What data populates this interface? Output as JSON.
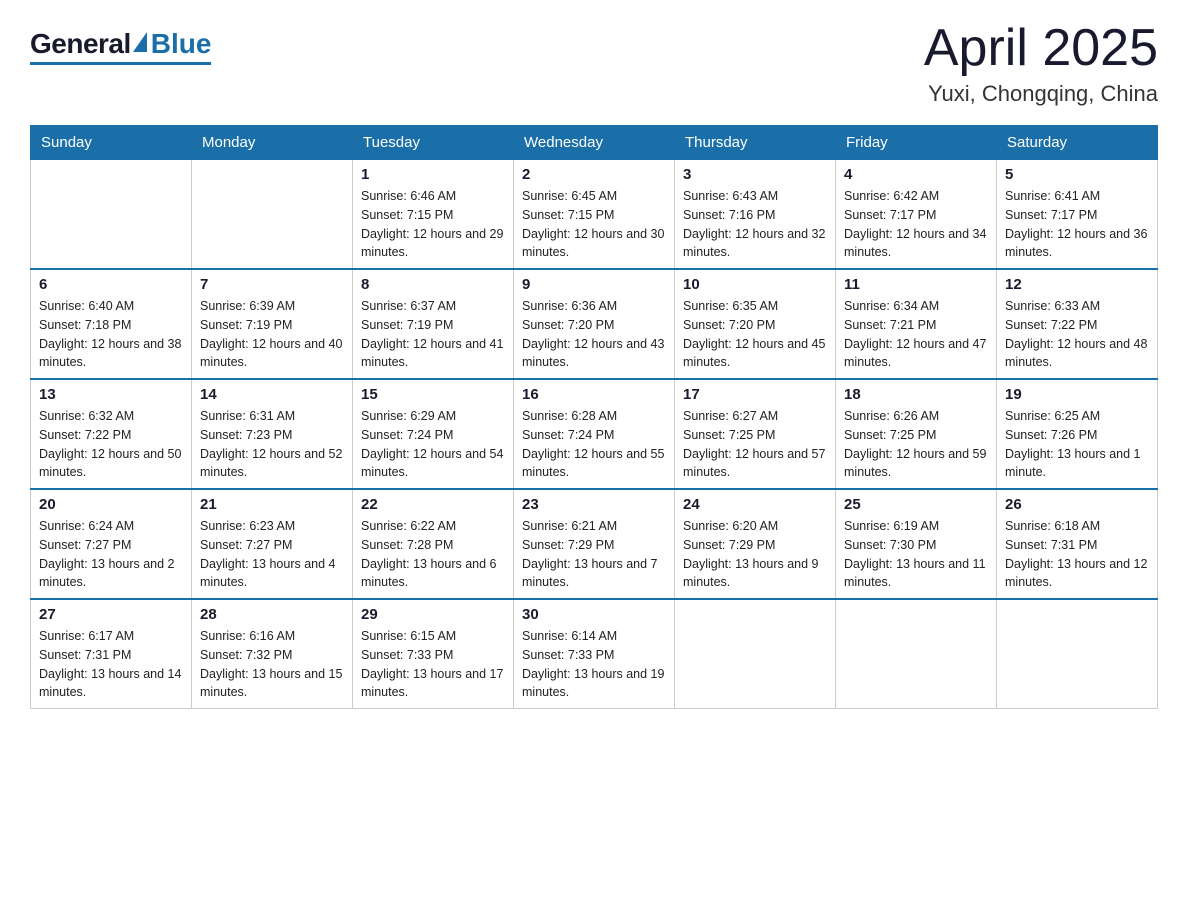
{
  "header": {
    "logo_general": "General",
    "logo_blue": "Blue",
    "month_title": "April 2025",
    "location": "Yuxi, Chongqing, China"
  },
  "weekdays": [
    "Sunday",
    "Monday",
    "Tuesday",
    "Wednesday",
    "Thursday",
    "Friday",
    "Saturday"
  ],
  "weeks": [
    [
      null,
      null,
      {
        "day": "1",
        "sunrise": "6:46 AM",
        "sunset": "7:15 PM",
        "daylight": "12 hours and 29 minutes."
      },
      {
        "day": "2",
        "sunrise": "6:45 AM",
        "sunset": "7:15 PM",
        "daylight": "12 hours and 30 minutes."
      },
      {
        "day": "3",
        "sunrise": "6:43 AM",
        "sunset": "7:16 PM",
        "daylight": "12 hours and 32 minutes."
      },
      {
        "day": "4",
        "sunrise": "6:42 AM",
        "sunset": "7:17 PM",
        "daylight": "12 hours and 34 minutes."
      },
      {
        "day": "5",
        "sunrise": "6:41 AM",
        "sunset": "7:17 PM",
        "daylight": "12 hours and 36 minutes."
      }
    ],
    [
      {
        "day": "6",
        "sunrise": "6:40 AM",
        "sunset": "7:18 PM",
        "daylight": "12 hours and 38 minutes."
      },
      {
        "day": "7",
        "sunrise": "6:39 AM",
        "sunset": "7:19 PM",
        "daylight": "12 hours and 40 minutes."
      },
      {
        "day": "8",
        "sunrise": "6:37 AM",
        "sunset": "7:19 PM",
        "daylight": "12 hours and 41 minutes."
      },
      {
        "day": "9",
        "sunrise": "6:36 AM",
        "sunset": "7:20 PM",
        "daylight": "12 hours and 43 minutes."
      },
      {
        "day": "10",
        "sunrise": "6:35 AM",
        "sunset": "7:20 PM",
        "daylight": "12 hours and 45 minutes."
      },
      {
        "day": "11",
        "sunrise": "6:34 AM",
        "sunset": "7:21 PM",
        "daylight": "12 hours and 47 minutes."
      },
      {
        "day": "12",
        "sunrise": "6:33 AM",
        "sunset": "7:22 PM",
        "daylight": "12 hours and 48 minutes."
      }
    ],
    [
      {
        "day": "13",
        "sunrise": "6:32 AM",
        "sunset": "7:22 PM",
        "daylight": "12 hours and 50 minutes."
      },
      {
        "day": "14",
        "sunrise": "6:31 AM",
        "sunset": "7:23 PM",
        "daylight": "12 hours and 52 minutes."
      },
      {
        "day": "15",
        "sunrise": "6:29 AM",
        "sunset": "7:24 PM",
        "daylight": "12 hours and 54 minutes."
      },
      {
        "day": "16",
        "sunrise": "6:28 AM",
        "sunset": "7:24 PM",
        "daylight": "12 hours and 55 minutes."
      },
      {
        "day": "17",
        "sunrise": "6:27 AM",
        "sunset": "7:25 PM",
        "daylight": "12 hours and 57 minutes."
      },
      {
        "day": "18",
        "sunrise": "6:26 AM",
        "sunset": "7:25 PM",
        "daylight": "12 hours and 59 minutes."
      },
      {
        "day": "19",
        "sunrise": "6:25 AM",
        "sunset": "7:26 PM",
        "daylight": "13 hours and 1 minute."
      }
    ],
    [
      {
        "day": "20",
        "sunrise": "6:24 AM",
        "sunset": "7:27 PM",
        "daylight": "13 hours and 2 minutes."
      },
      {
        "day": "21",
        "sunrise": "6:23 AM",
        "sunset": "7:27 PM",
        "daylight": "13 hours and 4 minutes."
      },
      {
        "day": "22",
        "sunrise": "6:22 AM",
        "sunset": "7:28 PM",
        "daylight": "13 hours and 6 minutes."
      },
      {
        "day": "23",
        "sunrise": "6:21 AM",
        "sunset": "7:29 PM",
        "daylight": "13 hours and 7 minutes."
      },
      {
        "day": "24",
        "sunrise": "6:20 AM",
        "sunset": "7:29 PM",
        "daylight": "13 hours and 9 minutes."
      },
      {
        "day": "25",
        "sunrise": "6:19 AM",
        "sunset": "7:30 PM",
        "daylight": "13 hours and 11 minutes."
      },
      {
        "day": "26",
        "sunrise": "6:18 AM",
        "sunset": "7:31 PM",
        "daylight": "13 hours and 12 minutes."
      }
    ],
    [
      {
        "day": "27",
        "sunrise": "6:17 AM",
        "sunset": "7:31 PM",
        "daylight": "13 hours and 14 minutes."
      },
      {
        "day": "28",
        "sunrise": "6:16 AM",
        "sunset": "7:32 PM",
        "daylight": "13 hours and 15 minutes."
      },
      {
        "day": "29",
        "sunrise": "6:15 AM",
        "sunset": "7:33 PM",
        "daylight": "13 hours and 17 minutes."
      },
      {
        "day": "30",
        "sunrise": "6:14 AM",
        "sunset": "7:33 PM",
        "daylight": "13 hours and 19 minutes."
      },
      null,
      null,
      null
    ]
  ]
}
